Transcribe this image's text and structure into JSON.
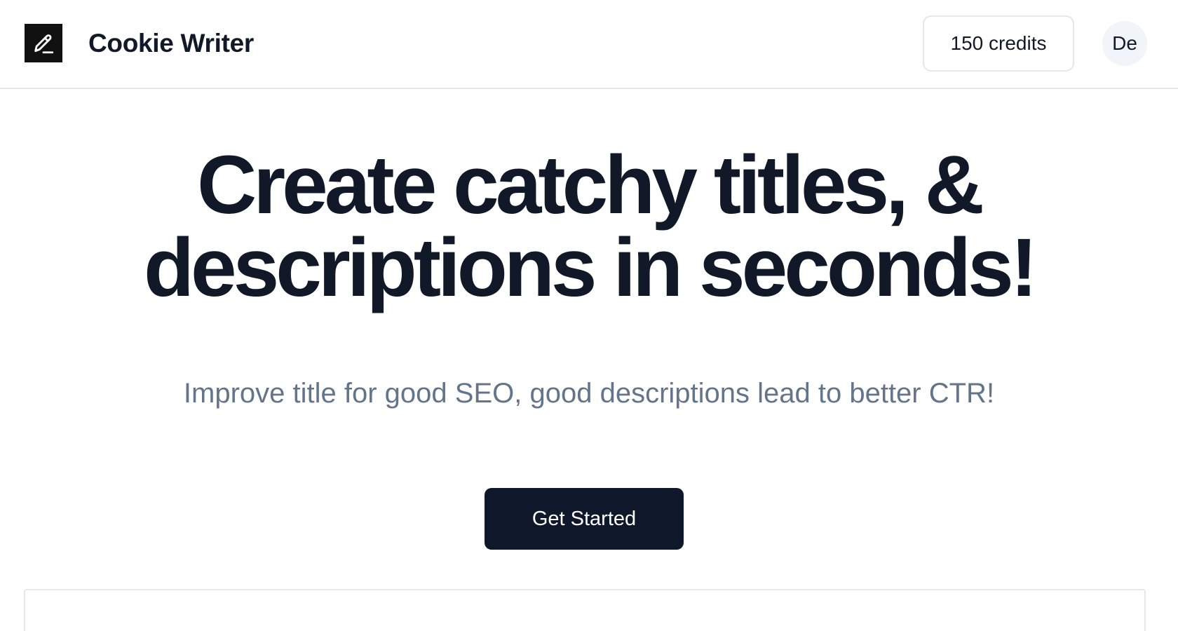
{
  "navbar": {
    "logo_icon": "pencil-edit-icon",
    "brand": "Cookie Writer",
    "credits": "150 credits",
    "avatar_initials": "De"
  },
  "hero": {
    "title_line1": "Create catchy titles, &",
    "title_line2": "descriptions in seconds!",
    "subtitle": "Improve title for good SEO, good descriptions lead to better CTR!",
    "cta_label": "Get Started"
  },
  "colors": {
    "text_primary": "#111827",
    "text_muted": "#64748b",
    "button_bg": "#0f172a",
    "border": "#e5e7eb",
    "avatar_bg": "#f1f5f9"
  }
}
